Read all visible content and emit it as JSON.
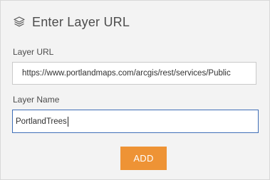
{
  "header": {
    "icon": "layers-icon",
    "title": "Enter Layer URL"
  },
  "form": {
    "layer_url": {
      "label": "Layer URL",
      "value": "https://www.portlandmaps.com/arcgis/rest/services/Public"
    },
    "layer_name": {
      "label": "Layer Name",
      "value": "PortlandTrees"
    }
  },
  "actions": {
    "add_label": "ADD"
  },
  "colors": {
    "accent": "#ee9335",
    "focus_border": "#3f6eb7"
  }
}
